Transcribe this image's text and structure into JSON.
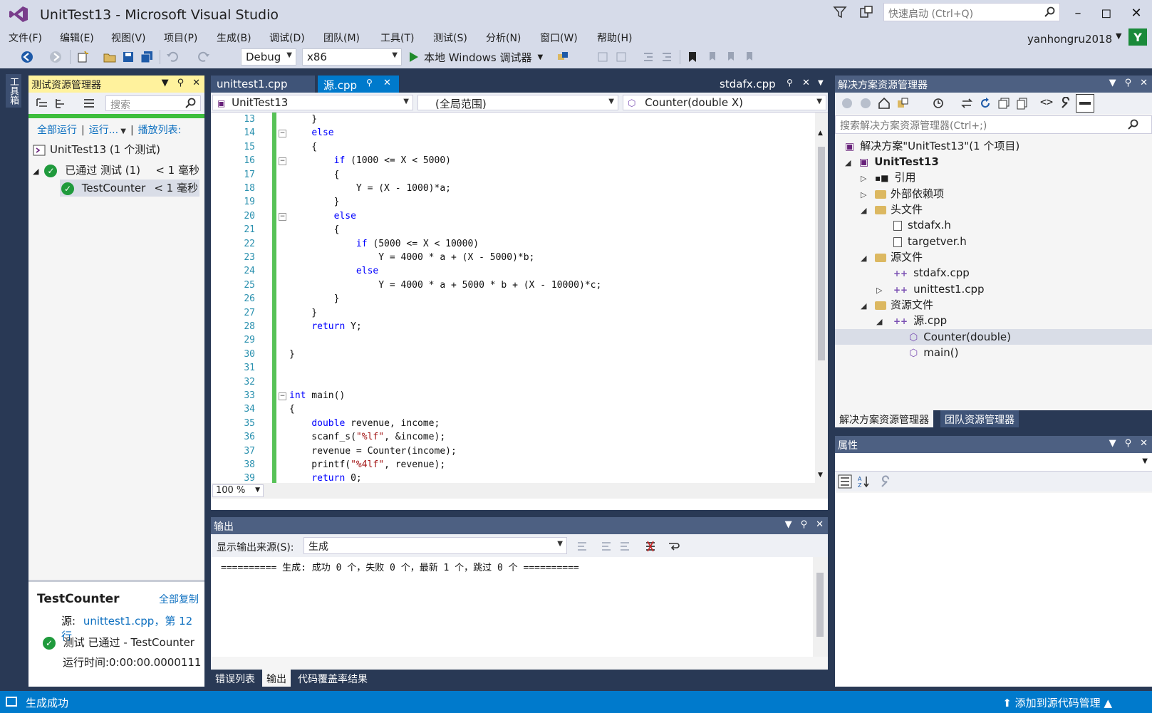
{
  "window": {
    "title": "UnitTest13 - Microsoft Visual Studio",
    "quick_launch_placeholder": "快速启动 (Ctrl+Q)",
    "user_name": "yanhongru2018",
    "user_initial": "Y"
  },
  "menu": [
    "文件(F)",
    "编辑(E)",
    "视图(V)",
    "项目(P)",
    "生成(B)",
    "调试(D)",
    "团队(M)",
    "工具(T)",
    "测试(S)",
    "分析(N)",
    "窗口(W)",
    "帮助(H)"
  ],
  "toolbar": {
    "config": "Debug",
    "platform": "x86",
    "run_label": "本地 Windows 调试器"
  },
  "toolbox_tab": "工具箱",
  "test_explorer": {
    "title": "测试资源管理器",
    "search_placeholder": "搜索",
    "run_all": "全部运行",
    "run": "运行...",
    "playlist": "播放列表:",
    "project_node": "UnitTest13 (1 个测试)",
    "passed_group": "已通过 测试 (1)",
    "passed_time": "< 1 毫秒",
    "test_name": "TestCounter",
    "test_time": "< 1 毫秒",
    "detail": {
      "name": "TestCounter",
      "copy_all": "全部复制",
      "source_label": "源:",
      "source_link": "unittest1.cpp，第 12 行",
      "status": "测试 已通过 - TestCounter",
      "elapsed": "运行时间:0:00:00.0000111"
    }
  },
  "editor": {
    "tabs": [
      {
        "label": "unittest1.cpp"
      },
      {
        "label": "源.cpp"
      },
      {
        "label": "stdafx.cpp"
      }
    ],
    "nav": {
      "project": "UnitTest13",
      "scope": "(全局范围)",
      "member": "Counter(double X)"
    },
    "zoom": "100 %",
    "lines": [
      {
        "n": "13",
        "code": "    }"
      },
      {
        "n": "14",
        "code": "    else"
      },
      {
        "n": "15",
        "code": "    {"
      },
      {
        "n": "16",
        "code": "        if (1000 <= X < 5000)"
      },
      {
        "n": "17",
        "code": "        {"
      },
      {
        "n": "18",
        "code": "            Y = (X - 1000)*a;"
      },
      {
        "n": "19",
        "code": "        }"
      },
      {
        "n": "20",
        "code": "        else"
      },
      {
        "n": "21",
        "code": "        {"
      },
      {
        "n": "22",
        "code": "            if (5000 <= X < 10000)"
      },
      {
        "n": "23",
        "code": "                Y = 4000 * a + (X - 5000)*b;"
      },
      {
        "n": "24",
        "code": "            else"
      },
      {
        "n": "25",
        "code": "                Y = 4000 * a + 5000 * b + (X - 10000)*c;"
      },
      {
        "n": "26",
        "code": "        }"
      },
      {
        "n": "27",
        "code": "    }"
      },
      {
        "n": "28",
        "code": "    return Y;"
      },
      {
        "n": "29",
        "code": ""
      },
      {
        "n": "30",
        "code": "}"
      },
      {
        "n": "31",
        "code": ""
      },
      {
        "n": "32",
        "code": ""
      },
      {
        "n": "33",
        "code": "int main()"
      },
      {
        "n": "34",
        "code": "{"
      },
      {
        "n": "35",
        "code": "    double revenue, income;"
      },
      {
        "n": "36",
        "code": "    scanf_s(\"%lf\", &income);"
      },
      {
        "n": "37",
        "code": "    revenue = Counter(income);"
      },
      {
        "n": "38",
        "code": "    printf(\"%4lf\", revenue);"
      },
      {
        "n": "39",
        "code": "    return 0;"
      }
    ]
  },
  "output": {
    "title": "输出",
    "source_label": "显示输出来源(S):",
    "source_value": "生成",
    "text": "========== 生成: 成功 0 个，失败 0 个，最新 1 个，跳过 0 个 ==========",
    "tabs": [
      "错误列表",
      "输出",
      "代码覆盖率结果"
    ]
  },
  "solution": {
    "title": "解决方案资源管理器",
    "search_placeholder": "搜索解决方案资源管理器(Ctrl+;)",
    "items": [
      {
        "label": "解决方案\"UnitTest13\"(1 个项目)"
      },
      {
        "label": "UnitTest13"
      },
      {
        "label": "引用"
      },
      {
        "label": "外部依赖项"
      },
      {
        "label": "头文件"
      },
      {
        "label": "stdafx.h"
      },
      {
        "label": "targetver.h"
      },
      {
        "label": "源文件"
      },
      {
        "label": "stdafx.cpp"
      },
      {
        "label": "unittest1.cpp"
      },
      {
        "label": "资源文件"
      },
      {
        "label": "源.cpp"
      },
      {
        "label": "Counter(double)"
      },
      {
        "label": "main()"
      }
    ],
    "tabs": [
      "解决方案资源管理器",
      "团队资源管理器"
    ]
  },
  "properties": {
    "title": "属性"
  },
  "status": {
    "left": "生成成功",
    "right": "添加到源代码管理"
  },
  "colors": {
    "accent": "#007acc",
    "active_header": "#fff29d",
    "pass_green": "#1f9a3c",
    "keyword": "#0000ff",
    "string": "#a31515",
    "line_number": "#2b91af"
  }
}
